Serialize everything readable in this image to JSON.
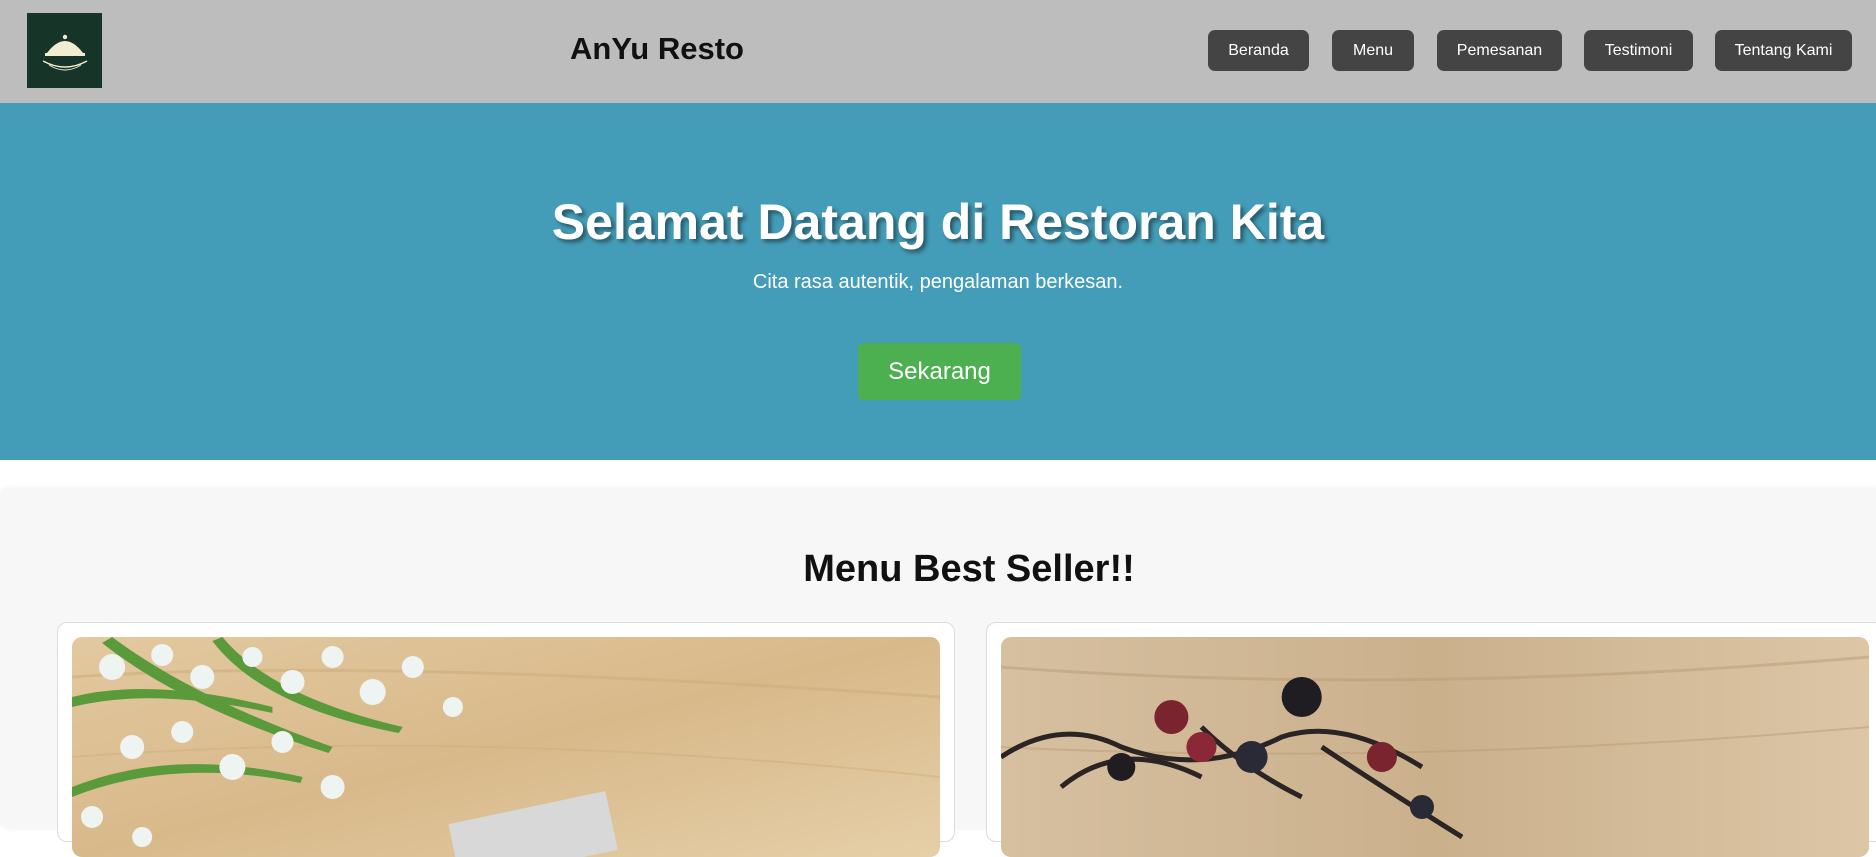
{
  "header": {
    "brand": "AnYu Resto",
    "logo_icon": "restaurant-cloche-logo",
    "nav": [
      {
        "label": "Beranda"
      },
      {
        "label": "Menu"
      },
      {
        "label": "Pemesanan"
      },
      {
        "label": "Testimoni"
      },
      {
        "label": "Tentang Kami"
      }
    ]
  },
  "hero": {
    "title": "Selamat Datang di Restoran Kita",
    "subtitle": "Cita rasa autentik, pengalaman berkesan.",
    "cta": "Sekarang"
  },
  "best_seller": {
    "title": "Menu Best Seller!!"
  },
  "colors": {
    "header_bg": "#bcbdbc",
    "nav_button": "#444444",
    "hero_bg": "#449db8",
    "cta_green": "#4caf50",
    "logo_bg": "#173428"
  }
}
